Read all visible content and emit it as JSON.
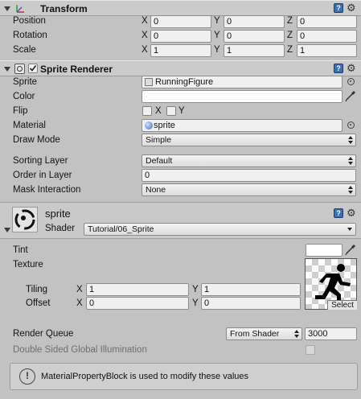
{
  "transform": {
    "title": "Transform",
    "rows": [
      {
        "label": "Position",
        "x": "0",
        "y": "0",
        "z": "0"
      },
      {
        "label": "Rotation",
        "x": "0",
        "y": "0",
        "z": "0"
      },
      {
        "label": "Scale",
        "x": "1",
        "y": "1",
        "z": "1"
      }
    ],
    "axis_x": "X",
    "axis_y": "Y",
    "axis_z": "Z"
  },
  "sprite_renderer": {
    "title": "Sprite Renderer",
    "sprite_label": "Sprite",
    "sprite_value": "RunningFigure",
    "color_label": "Color",
    "flip_label": "Flip",
    "flip_x": "X",
    "flip_y": "Y",
    "material_label": "Material",
    "material_value": "sprite",
    "draw_mode_label": "Draw Mode",
    "draw_mode_value": "Simple",
    "sorting_layer_label": "Sorting Layer",
    "sorting_layer_value": "Default",
    "order_label": "Order in Layer",
    "order_value": "0",
    "mask_label": "Mask Interaction",
    "mask_value": "None"
  },
  "material": {
    "name": "sprite",
    "shader_label": "Shader",
    "shader_value": "Tutorial/06_Sprite",
    "tint_label": "Tint",
    "texture_label": "Texture",
    "select_label": "Select",
    "tiling_label": "Tiling",
    "tiling_x": "1",
    "tiling_y": "1",
    "offset_label": "Offset",
    "offset_x": "0",
    "offset_y": "0",
    "axis_x": "X",
    "axis_y": "Y",
    "render_queue_label": "Render Queue",
    "render_queue_mode": "From Shader",
    "render_queue_value": "3000",
    "dsgi_label": "Double Sided Global Illumination"
  },
  "helpbox": {
    "icon_glyph": "!",
    "message": "MaterialPropertyBlock is used to modify these values"
  },
  "colors": {
    "panel_bg": "#c2c2c2",
    "header_bg": "#cbcbcb",
    "field_bg": "#f0f0f0",
    "help_icon_blue": "#3e6fb0"
  }
}
